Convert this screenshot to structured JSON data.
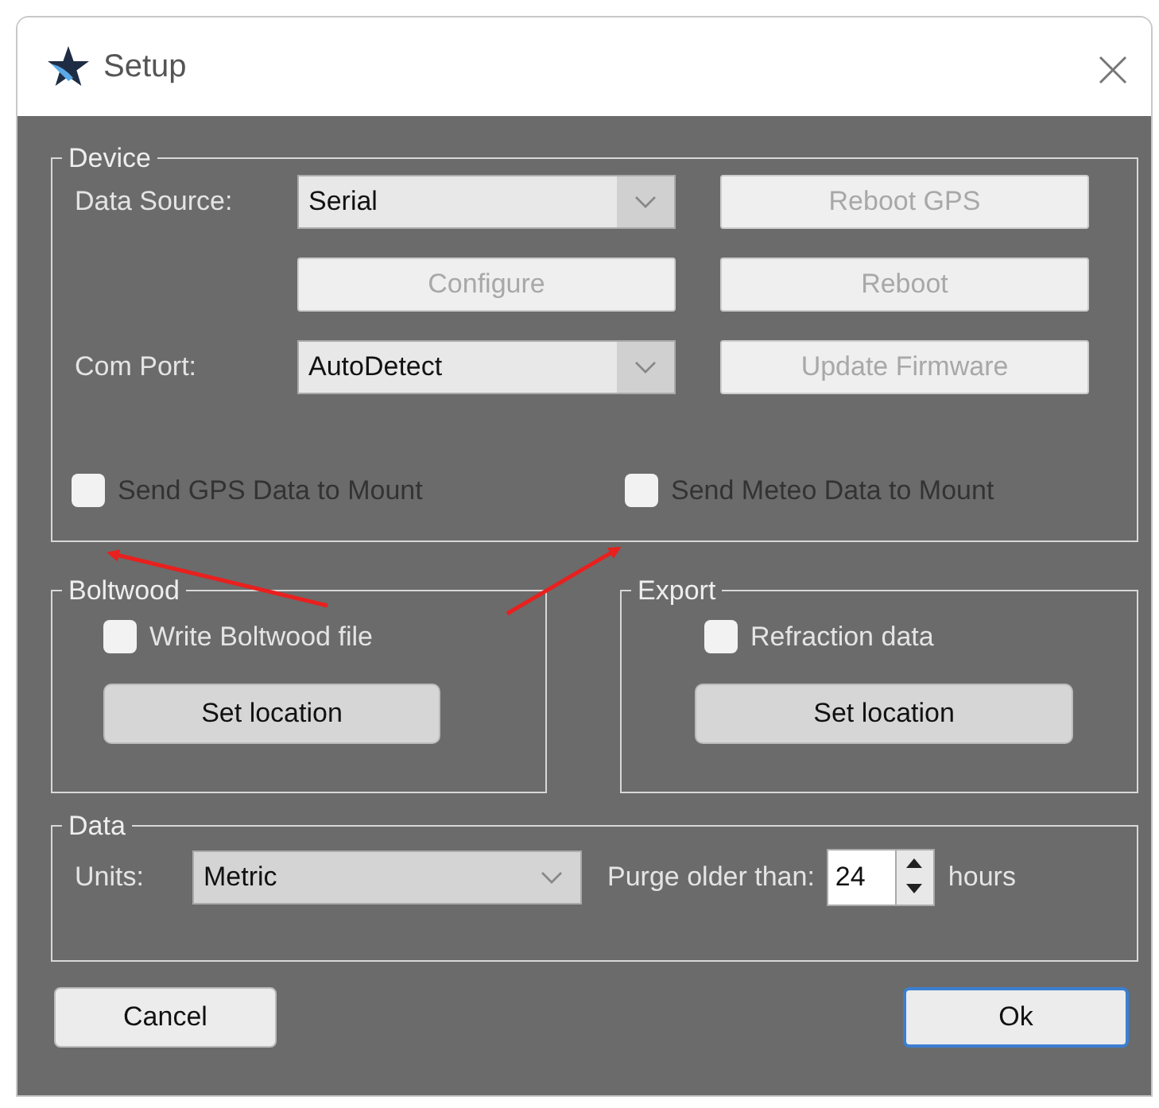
{
  "window": {
    "title": "Setup"
  },
  "device": {
    "legend": "Device",
    "data_source": {
      "label": "Data Source:",
      "value": "Serial"
    },
    "com_port": {
      "label": "Com Port:",
      "value": "AutoDetect"
    },
    "buttons": [
      {
        "label": "Reboot GPS",
        "disabled": true
      },
      {
        "label": "Configure",
        "disabled": true
      },
      {
        "label": "Reboot",
        "disabled": true
      },
      {
        "label": "Update Firmware",
        "disabled": true
      }
    ],
    "checkboxes": [
      {
        "label": "Send GPS Data to Mount",
        "checked": false
      },
      {
        "label": "Send Meteo Data to Mount",
        "checked": false
      }
    ]
  },
  "boltwood": {
    "legend": "Boltwood",
    "checkbox": {
      "label": "Write Boltwood file",
      "checked": false
    },
    "button": "Set location"
  },
  "export": {
    "legend": "Export",
    "checkbox": {
      "label": "Refraction data",
      "checked": false
    },
    "button": "Set location"
  },
  "data": {
    "legend": "Data",
    "units_label": "Units:",
    "units_value": "Metric",
    "purge_label": "Purge older than:",
    "purge_value": "24",
    "hours_label": "hours"
  },
  "buttons": [
    {
      "label": "Cancel",
      "default": false
    },
    {
      "label": "Ok",
      "default": true
    }
  ]
}
